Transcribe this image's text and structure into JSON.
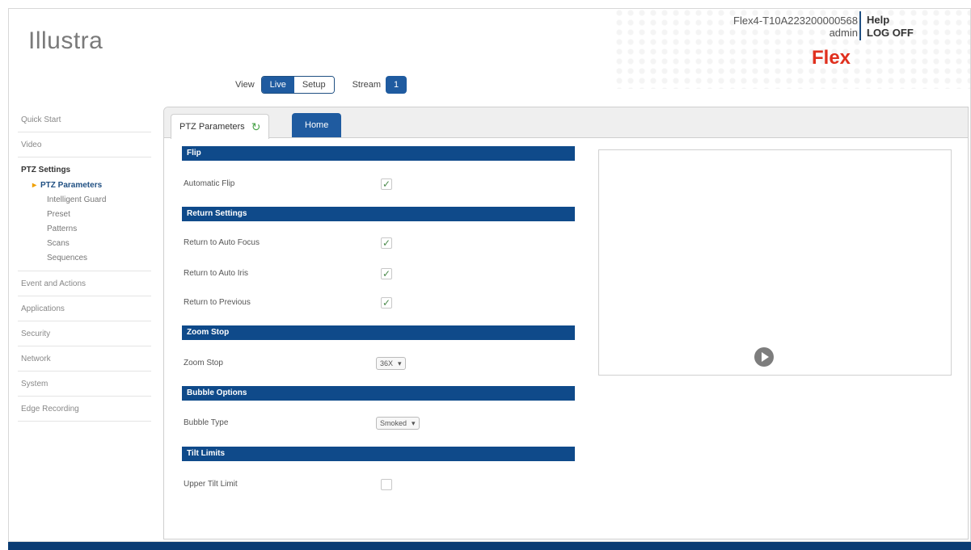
{
  "header": {
    "logo": "Illustra",
    "device_id": "Flex4-T10A223200000568",
    "user": "admin",
    "help": "Help",
    "logoff": "LOG OFF",
    "product": "Flex"
  },
  "view_bar": {
    "view_label": "View",
    "live": "Live",
    "setup": "Setup",
    "stream_label": "Stream",
    "stream_value": "1"
  },
  "sidebar": {
    "items_top": [
      "Quick Start",
      "Video"
    ],
    "group": {
      "title": "PTZ Settings",
      "subitems": [
        "PTZ Parameters",
        "Intelligent Guard",
        "Preset",
        "Patterns",
        "Scans",
        "Sequences"
      ]
    },
    "items_bottom": [
      "Event and Actions",
      "Applications",
      "Security",
      "Network",
      "System",
      "Edge Recording"
    ]
  },
  "tabs": {
    "active": "PTZ Parameters",
    "inactive": "Home"
  },
  "sections": {
    "flip": {
      "title": "Flip",
      "automatic_flip": {
        "label": "Automatic Flip",
        "checked": true
      }
    },
    "return_settings": {
      "title": "Return Settings",
      "auto_focus": {
        "label": "Return to Auto Focus",
        "checked": true
      },
      "auto_iris": {
        "label": "Return to Auto Iris",
        "checked": true
      },
      "previous": {
        "label": "Return to Previous",
        "checked": true
      }
    },
    "zoom_stop": {
      "title": "Zoom Stop",
      "label": "Zoom Stop",
      "value": "36X"
    },
    "bubble_options": {
      "title": "Bubble Options",
      "label": "Bubble Type",
      "value": "Smoked"
    },
    "tilt_limits": {
      "title": "Tilt Limits",
      "upper": {
        "label": "Upper Tilt Limit",
        "checked": false
      }
    }
  },
  "glyphs": {
    "check": "✓",
    "caret": "▾",
    "refresh": "↻"
  }
}
